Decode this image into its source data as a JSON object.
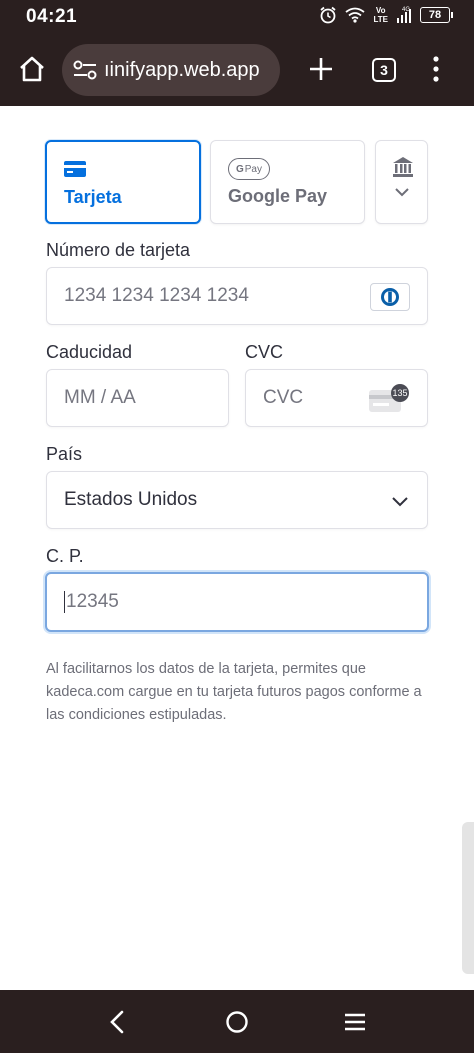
{
  "status_bar": {
    "time": "04:21",
    "network_label_top": "Vo",
    "network_label_bottom": "LTE",
    "network_type": "4G",
    "battery": "78",
    "icons": [
      "alarm-icon",
      "wifi-icon",
      "signal-icon",
      "battery-icon"
    ]
  },
  "browser": {
    "url": "ıinifyapp.web.app",
    "tab_count": "3",
    "icons": [
      "home-icon",
      "site-settings-icon",
      "new-tab-icon",
      "tab-switcher-icon",
      "menu-icon"
    ]
  },
  "payment_methods": [
    {
      "label": "Tarjeta",
      "icon": "credit-card-icon",
      "selected": true
    },
    {
      "label": "Google Pay",
      "icon": "google-pay-badge",
      "badge_text": "Pay",
      "selected": false
    },
    {
      "label": "",
      "icon": "bank-icon",
      "selected": false
    }
  ],
  "form": {
    "card_number": {
      "label": "Número de tarjeta",
      "placeholder": "1234 1234 1234 1234",
      "icon": "diners-card-icon"
    },
    "expiry": {
      "label": "Caducidad",
      "placeholder": "MM / AA"
    },
    "cvc": {
      "label": "CVC",
      "placeholder": "CVC",
      "icon": "cvc-card-icon",
      "icon_text": "135"
    },
    "country": {
      "label": "País",
      "value": "Estados Unidos"
    },
    "postal_code": {
      "label": "C. P.",
      "placeholder": "12345"
    }
  },
  "disclaimer": "Al facilitarnos los datos de la tarjeta, permites que kadeca.com cargue en tu tarjeta futuros pagos conforme a las condiciones estipuladas.",
  "colors": {
    "accent": "#0570de",
    "bar": "#2a1f1f",
    "text": "#30313d",
    "muted": "#6d6e78"
  }
}
